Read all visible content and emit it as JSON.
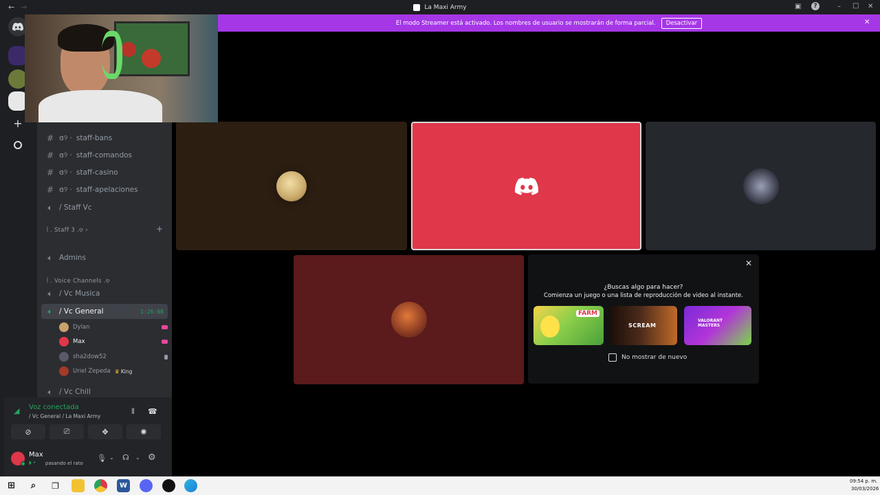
{
  "window": {
    "title": "La Maxi Army",
    "back_icon": "arrow-left",
    "forward_icon": "arrow-right",
    "minimize": "–",
    "maximize": "□",
    "close": "✕"
  },
  "banner": {
    "text": "El modo Streamer está activado. Los nombres de usuario se mostrarán de forma parcial.",
    "button": "Desactivar",
    "close": "✕",
    "color": "#a537e6"
  },
  "sidebar": {
    "channels": [
      {
        "name": "ꈍ୨ : 🀆 · staff-bans",
        "label": "staff-bans",
        "prefix": "ɞ୨ ·"
      },
      {
        "name": "staff-comandos",
        "label": "staff-comandos",
        "prefix": "ɞ୨ ·"
      },
      {
        "name": "staff-casino",
        "label": "staff-casino",
        "prefix": "ɞ୨ ·"
      },
      {
        "name": "staff-apelaciones",
        "label": "staff-apelaciones",
        "prefix": "ɞ୨ ·"
      }
    ],
    "staff_vc": "/ Staff Vc",
    "category_staff3": "꒰. Staff 3 .𖹭 ›",
    "admins": "Admins",
    "category_voice": "꒰. Voice Channels .𖹭",
    "vc_musica": "/ Vc Musica",
    "vc_general": "/ Vc General",
    "vc_general_timer": "1:26:08",
    "members": [
      {
        "name": "Dylan",
        "tag": ""
      },
      {
        "name": "Max",
        "tag": ""
      },
      {
        "name": "sha2dow52",
        "tag": ""
      },
      {
        "name": "Uriel Zepeda",
        "tag": "King"
      }
    ],
    "vc_chill": "/ Vc Chill"
  },
  "voice": {
    "status": "Voz conectada",
    "location": "/ Vc General / La Maxi Army"
  },
  "user": {
    "name": "Max",
    "status": "pasando el rato"
  },
  "activity": {
    "question": "¿Buscas algo para hacer?",
    "subtitle": "Comienza un juego o una lista de reproducción de video al instante.",
    "games": [
      {
        "name": "FARM",
        "color": "#7cc24a"
      },
      {
        "name": "SCREAM",
        "color": "#4a2a1a"
      },
      {
        "name": "VALORANT MASTERS",
        "color": "#b235d8"
      }
    ],
    "checkbox_label": "No mostrar de nuevo"
  },
  "taskbar": {
    "time": "09:54 p. m.",
    "date": "30/03/2026"
  },
  "colors": {
    "discord_red": "#e0374a",
    "tile_brown": "#2d1e12",
    "tile_gray": "#25282c",
    "tile_maroon": "#5b1a1b",
    "connected_green": "#23a55a"
  }
}
